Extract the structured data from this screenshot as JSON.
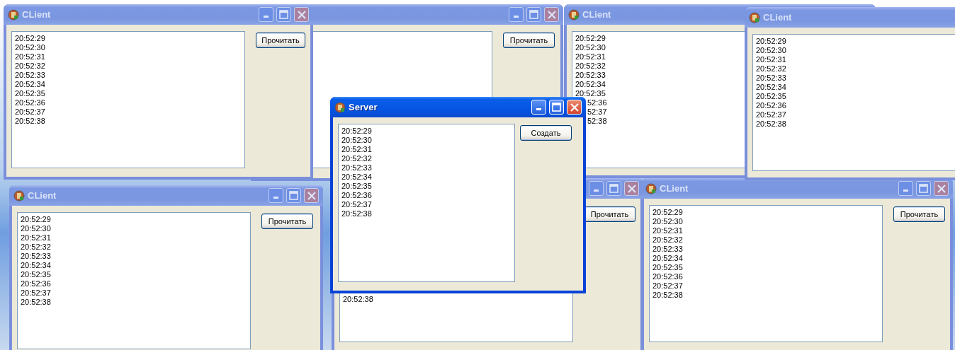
{
  "windows": [
    {
      "kind": "client",
      "title": "CLient",
      "active": false,
      "caption_buttons": true,
      "lines": [
        "20:52:29",
        "20:52:30",
        "20:52:31",
        "20:52:32",
        "20:52:33",
        "20:52:34",
        "20:52:35",
        "20:52:36",
        "20:52:37",
        "20:52:38"
      ],
      "button": "Прочитать"
    },
    {
      "kind": "client",
      "active": false,
      "caption_buttons": true,
      "button": "Прочитать"
    },
    {
      "kind": "client",
      "title": "CLient",
      "active": false,
      "lines": [
        "20:52:29",
        "20:52:30",
        "20:52:31",
        "20:52:32",
        "20:52:33",
        "20:52:34",
        "20:52:35"
      ],
      "partial_lines": [
        "52:36",
        "52:37",
        "52:38"
      ]
    },
    {
      "kind": "client",
      "title": "CLient",
      "active": false,
      "lines": [
        "20:52:29",
        "20:52:30",
        "20:52:31",
        "20:52:32",
        "20:52:33",
        "20:52:34",
        "20:52:35",
        "20:52:36",
        "20:52:37",
        "20:52:38"
      ]
    },
    {
      "kind": "server",
      "title": "Server",
      "active": true,
      "caption_buttons": true,
      "lines": [
        "20:52:29",
        "20:52:30",
        "20:52:31",
        "20:52:32",
        "20:52:33",
        "20:52:34",
        "20:52:35",
        "20:52:36",
        "20:52:37",
        "20:52:38"
      ],
      "button": "Создать"
    },
    {
      "kind": "client",
      "title": "CLient",
      "active": false,
      "caption_buttons": true,
      "lines": [
        "20:52:29",
        "20:52:30",
        "20:52:31",
        "20:52:32",
        "20:52:33",
        "20:52:34",
        "20:52:35",
        "20:52:36",
        "20:52:37",
        "20:52:38"
      ],
      "button": "Прочитать"
    },
    {
      "kind": "client",
      "active": false,
      "caption_buttons": true,
      "top_rows_covered": true,
      "lines": [
        "20:52:38"
      ],
      "button": "Прочитать"
    },
    {
      "kind": "client",
      "title": "CLient",
      "active": false,
      "caption_buttons": true,
      "lines": [
        "20:52:29",
        "20:52:30",
        "20:52:31",
        "20:52:32",
        "20:52:33",
        "20:52:34",
        "20:52:35",
        "20:52:36",
        "20:52:37",
        "20:52:38"
      ],
      "button": "Прочитать"
    }
  ]
}
